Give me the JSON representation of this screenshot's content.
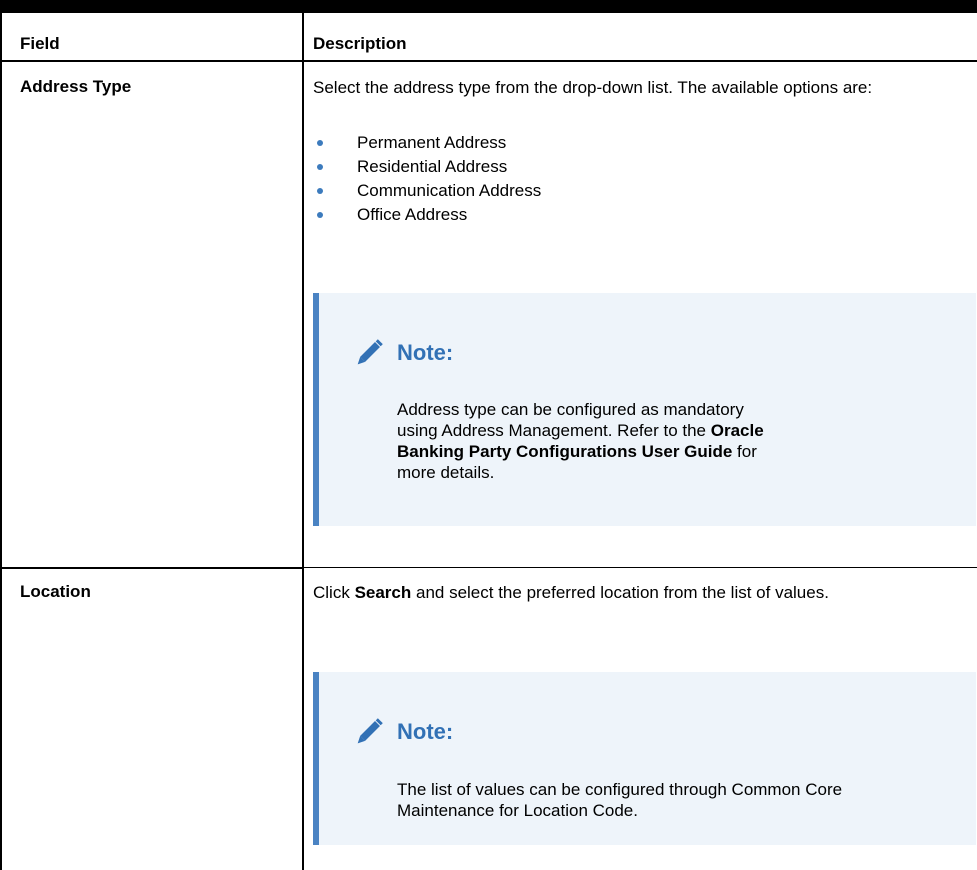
{
  "table": {
    "headers": {
      "field": "Field",
      "description": "Description"
    },
    "rows": [
      {
        "field": "Address Type",
        "description": "Select the address type from the drop-down list. The available options are:",
        "options": [
          "Permanent Address",
          "Residential Address",
          "Communication Address",
          "Office Address"
        ],
        "note": {
          "title": "Note:",
          "text_before": "Address type can be configured as mandatory using Address Management. Refer to the ",
          "text_bold": "Oracle Banking Party Configurations User Guide",
          "text_after": " for more details.",
          "icon": "pencil-icon"
        }
      },
      {
        "field": "Location",
        "desc_before": "Click ",
        "desc_bold": "Search",
        "desc_after": " and select the preferred location from the list of values.",
        "note": {
          "title": "Note:",
          "text": "The list of values can be configured through Common Core Maintenance for Location Code.",
          "icon": "pencil-icon"
        }
      }
    ]
  },
  "colors": {
    "note_accent": "#4a83c3",
    "note_background": "#eef4fa",
    "note_title": "#3271b5",
    "bullet": "#3c7bbd"
  }
}
